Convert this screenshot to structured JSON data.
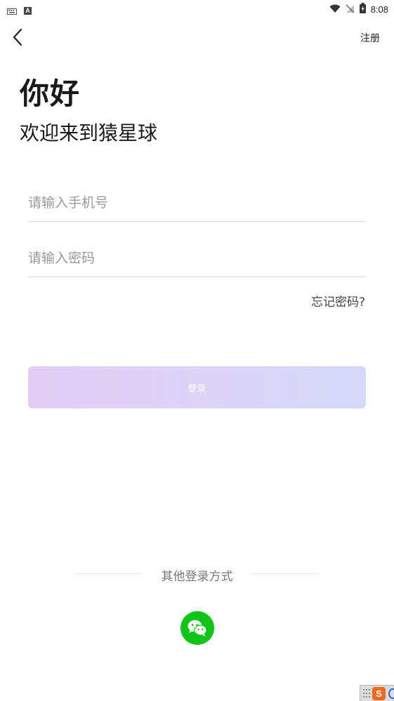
{
  "status_bar": {
    "time": "8:08",
    "ime_badge": "A",
    "icons": [
      "keyboard-icon",
      "ime-a-icon",
      "wifi-icon",
      "no-signal-icon",
      "battery-charging-icon"
    ]
  },
  "nav": {
    "register_label": "注册",
    "back_icon": "chevron-left-icon"
  },
  "header": {
    "greeting": "你好",
    "welcome": "欢迎来到猿星球"
  },
  "form": {
    "phone_placeholder": "请输入手机号",
    "phone_value": "",
    "password_placeholder": "请输入密码",
    "password_value": "",
    "forgot_label": "忘记密码?",
    "login_label": "登录"
  },
  "other_login": {
    "label": "其他登录方式",
    "providers": [
      "wechat-icon"
    ]
  },
  "ime_tray": {
    "sogou_label": "S"
  },
  "colors": {
    "login_gradient_start": "#e2cdf5",
    "login_gradient_end": "#d5d9f9",
    "wechat_green": "#11c418",
    "placeholder": "#9a9a9a",
    "divider": "#d9d9d9"
  }
}
